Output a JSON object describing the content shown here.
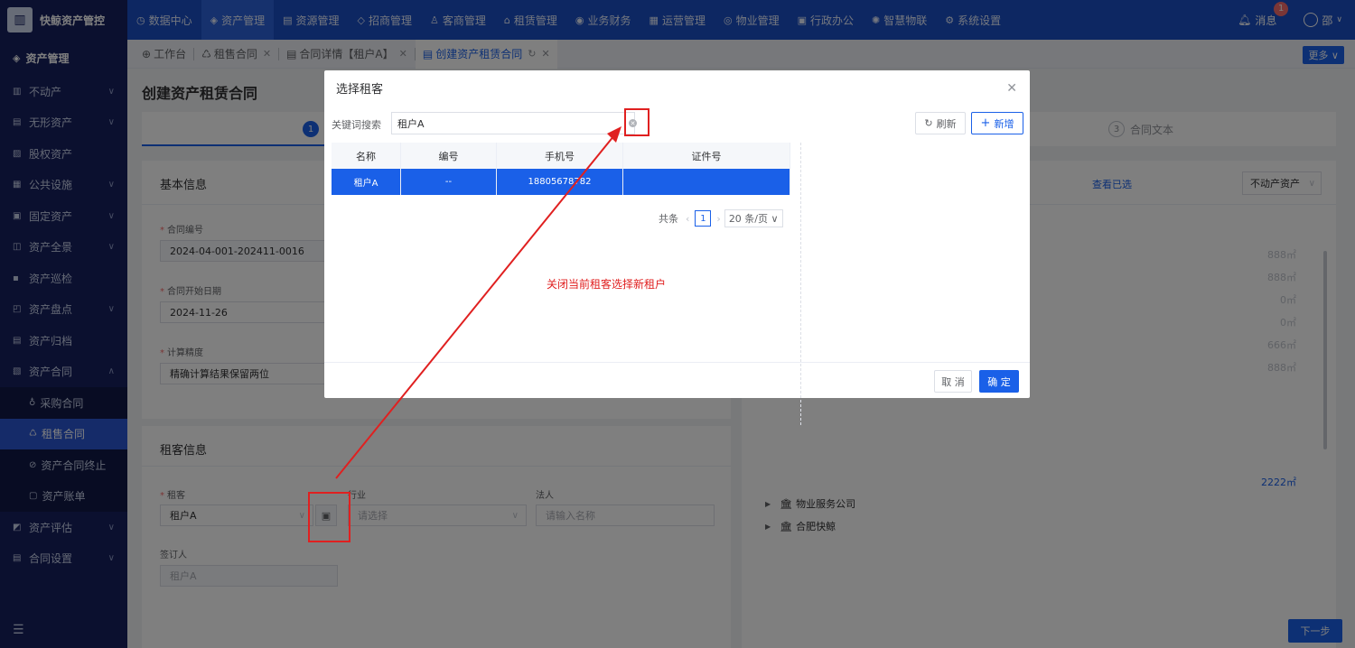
{
  "app": {
    "name": "快鲸资产管控"
  },
  "topnav": [
    {
      "label": "数据中心",
      "icon": "clock-icon"
    },
    {
      "label": "资产管理",
      "icon": "cube-icon",
      "active": true
    },
    {
      "label": "资源管理",
      "icon": "building-icon"
    },
    {
      "label": "招商管理",
      "icon": "tag-icon"
    },
    {
      "label": "客商管理",
      "icon": "people-icon"
    },
    {
      "label": "租赁管理",
      "icon": "house-icon"
    },
    {
      "label": "业务财务",
      "icon": "money-icon"
    },
    {
      "label": "运营管理",
      "icon": "grid-icon"
    },
    {
      "label": "物业管理",
      "icon": "service-icon"
    },
    {
      "label": "行政办公",
      "icon": "doc-icon"
    },
    {
      "label": "智慧物联",
      "icon": "iot-icon"
    },
    {
      "label": "系统设置",
      "icon": "gear-icon"
    }
  ],
  "header": {
    "messages_label": "消息",
    "message_count": "1",
    "user_name": "邵"
  },
  "sidebar": {
    "title": "资产管理",
    "items": [
      {
        "label": "不动产",
        "chev": true
      },
      {
        "label": "无形资产",
        "chev": true
      },
      {
        "label": "股权资产",
        "chev": false
      },
      {
        "label": "公共设施",
        "chev": true
      },
      {
        "label": "固定资产",
        "chev": true
      },
      {
        "label": "资产全景",
        "chev": true
      },
      {
        "label": "资产巡检",
        "chev": false
      },
      {
        "label": "资产盘点",
        "chev": true
      },
      {
        "label": "资产归档",
        "chev": false
      },
      {
        "label": "资产合同",
        "chev": true,
        "expanded": true
      }
    ],
    "sub_items": [
      {
        "label": "采购合同"
      },
      {
        "label": "租售合同",
        "active": true
      },
      {
        "label": "资产合同终止"
      },
      {
        "label": "资产账单"
      }
    ],
    "items_after": [
      {
        "label": "资产评估",
        "chev": true
      },
      {
        "label": "合同设置",
        "chev": true
      }
    ]
  },
  "tabs": [
    {
      "label": "工作台",
      "closable": false
    },
    {
      "label": "租售合同",
      "closable": true
    },
    {
      "label": "合同详情【租户A】",
      "closable": true
    },
    {
      "label": "创建资产租赁合同",
      "closable": true,
      "active": true
    }
  ],
  "more_label": "更多",
  "page": {
    "title": "创建资产租赁合同",
    "step1_num": "1",
    "step3_num": "3",
    "step3_label": "合同文本",
    "basic_info": {
      "title": "基本信息",
      "contract_no_label": "合同编号",
      "contract_no": "2024-04-001-202411-0016",
      "start_date_label": "合同开始日期",
      "start_date": "2024-11-26",
      "precision_label": "计算精度",
      "precision": "精确计算结果保留两位"
    },
    "tenant_info": {
      "title": "租客信息",
      "tenant_label": "租客",
      "tenant_value": "租户A",
      "industry_label": "行业",
      "industry_placeholder": "请选择",
      "legal_label": "法人",
      "legal_placeholder": "请输入名称",
      "signer_label": "签订人",
      "signer_value": "租户A"
    },
    "right_panel": {
      "view_selected": "查看已选",
      "property_type": "不动产资产",
      "areas": [
        "888㎡",
        "888㎡",
        "0㎡",
        "0㎡",
        "666㎡",
        "888㎡"
      ],
      "total_area": "2222㎡",
      "tree_nodes": [
        "物业服务公司",
        "合肥快鲸"
      ]
    },
    "next_label": "下一步"
  },
  "dialog": {
    "title": "选择租客",
    "keyword_label": "关键词搜索",
    "keyword_value": "租户A",
    "refresh_label": "刷新",
    "add_label": "新增",
    "columns": [
      "名称",
      "编号",
      "手机号",
      "证件号"
    ],
    "rows": [
      {
        "name": "租户A",
        "code": "--",
        "phone": "18805678782",
        "id_no": ""
      }
    ],
    "pager_total": "共条",
    "pager_page": "1",
    "pager_size": "20 条/页",
    "cancel_label": "取 消",
    "ok_label": "确 定"
  },
  "annotation": {
    "text": "关闭当前租客选择新租户",
    "color": "#e02020"
  },
  "colors": {
    "primary": "#1a60e8",
    "sidebar": "#16205f",
    "topbar": "#1a4fc4",
    "annotation": "#e02020"
  }
}
